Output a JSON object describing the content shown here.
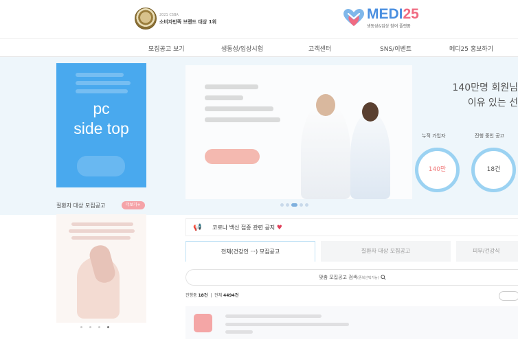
{
  "header": {
    "award_year": "2021 CSBA",
    "award_title": "소비자만족 브랜드 대상 1위",
    "logo_name_main": "MEDI",
    "logo_name_num": "25",
    "logo_tagline": "생동성&임상 참여 플랫폼",
    "brand_color": "#4a8fe0",
    "accent_color": "#f06b82"
  },
  "nav": {
    "items": [
      "모집공고 보기",
      "생동성/임상시험",
      "고객센터",
      "SNS/이벤트",
      "메디25 홍보하기"
    ]
  },
  "side": {
    "ad_label_line1": "pc",
    "ad_label_line2": "side top",
    "section_title": "질환자 대상 모집공고",
    "section_badge": "더보기+"
  },
  "hero": {
    "title_line1": "140만명 회원님",
    "title_line2": "이유 있는 선",
    "stats": [
      {
        "label": "누적 가입자",
        "value": "140만"
      },
      {
        "label": "진행 중인 공고",
        "value": "18건"
      }
    ]
  },
  "notice": {
    "icon": "megaphone-icon",
    "text": "코로나 백신 접종 관련 공지"
  },
  "tabs": [
    {
      "label": "전체(건강인 ···) 모집공고",
      "active": true
    },
    {
      "label": "질환자 대상 모집공고",
      "active": false
    },
    {
      "label": "피부/건강식",
      "active": false
    }
  ],
  "search": {
    "label": "맞춤 모집공고 검색",
    "hint": "(중복선택가능)"
  },
  "counts": {
    "ongoing_label": "진행중",
    "ongoing_value": "18건",
    "separator": "|",
    "total_label": "전체",
    "total_value": "4494건"
  }
}
